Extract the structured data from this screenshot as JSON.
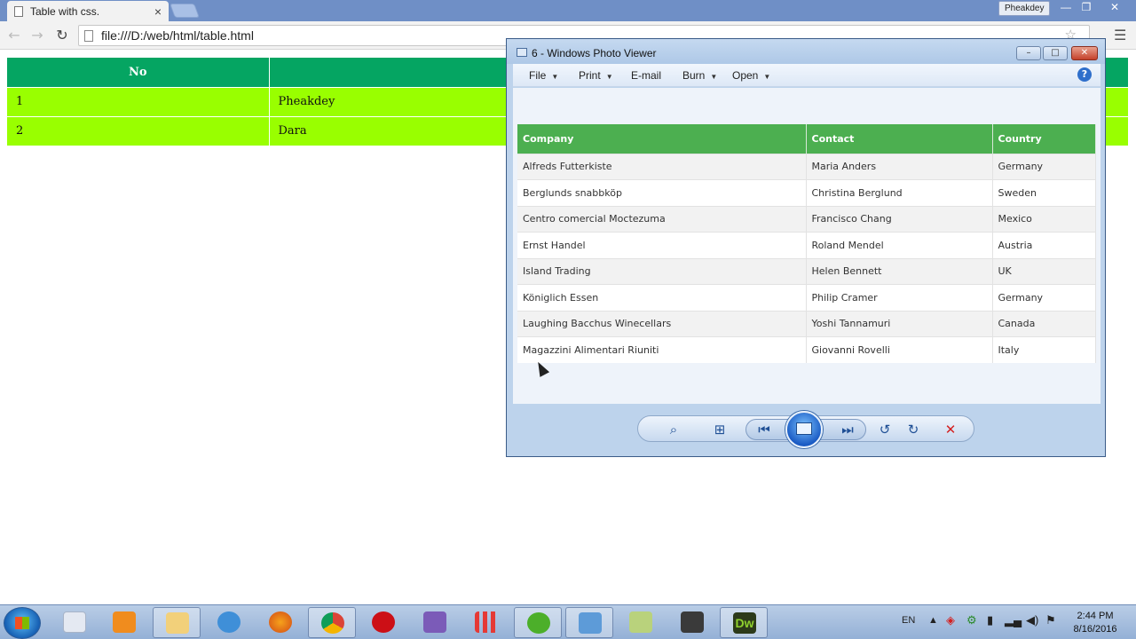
{
  "browser": {
    "tab_title": "Table with css.",
    "tab_close": "×",
    "profile": "Pheakdey",
    "url": "file:///D:/web/html/table.html",
    "nav_back": "←",
    "nav_forward": "→",
    "nav_reload": "↻",
    "menu": "☰",
    "bookmark": "☆"
  },
  "page_table": {
    "headers": [
      "No",
      ""
    ],
    "rows": [
      [
        "1",
        "Pheakdey"
      ],
      [
        "2",
        "Dara"
      ]
    ]
  },
  "photo_viewer": {
    "title": "6 - Windows Photo Viewer",
    "menus": [
      "File",
      "Print",
      "E-mail",
      "Burn",
      "Open"
    ],
    "help": "?",
    "table": {
      "headers": [
        "Company",
        "Contact",
        "Country"
      ],
      "rows": [
        [
          "Alfreds Futterkiste",
          "Maria Anders",
          "Germany"
        ],
        [
          "Berglunds snabbköp",
          "Christina Berglund",
          "Sweden"
        ],
        [
          "Centro comercial Moctezuma",
          "Francisco Chang",
          "Mexico"
        ],
        [
          "Ernst Handel",
          "Roland Mendel",
          "Austria"
        ],
        [
          "Island Trading",
          "Helen Bennett",
          "UK"
        ],
        [
          "Königlich Essen",
          "Philip Cramer",
          "Germany"
        ],
        [
          "Laughing Bacchus Winecellars",
          "Yoshi Tannamuri",
          "Canada"
        ],
        [
          "Magazzini Alimentari Riuniti",
          "Giovanni Rovelli",
          "Italy"
        ]
      ]
    }
  },
  "taskbar": {
    "language": "EN",
    "time": "2:44 PM",
    "date": "8/16/2016",
    "apps": [
      "snipping-tool",
      "media-player",
      "file-explorer",
      "internet-explorer",
      "firefox",
      "chrome",
      "opera",
      "visual-studio",
      "app-grid",
      "utorrent",
      "photo-viewer",
      "notes",
      "camera-app",
      "dreamweaver"
    ],
    "dreamweaver_label": "Dw"
  }
}
